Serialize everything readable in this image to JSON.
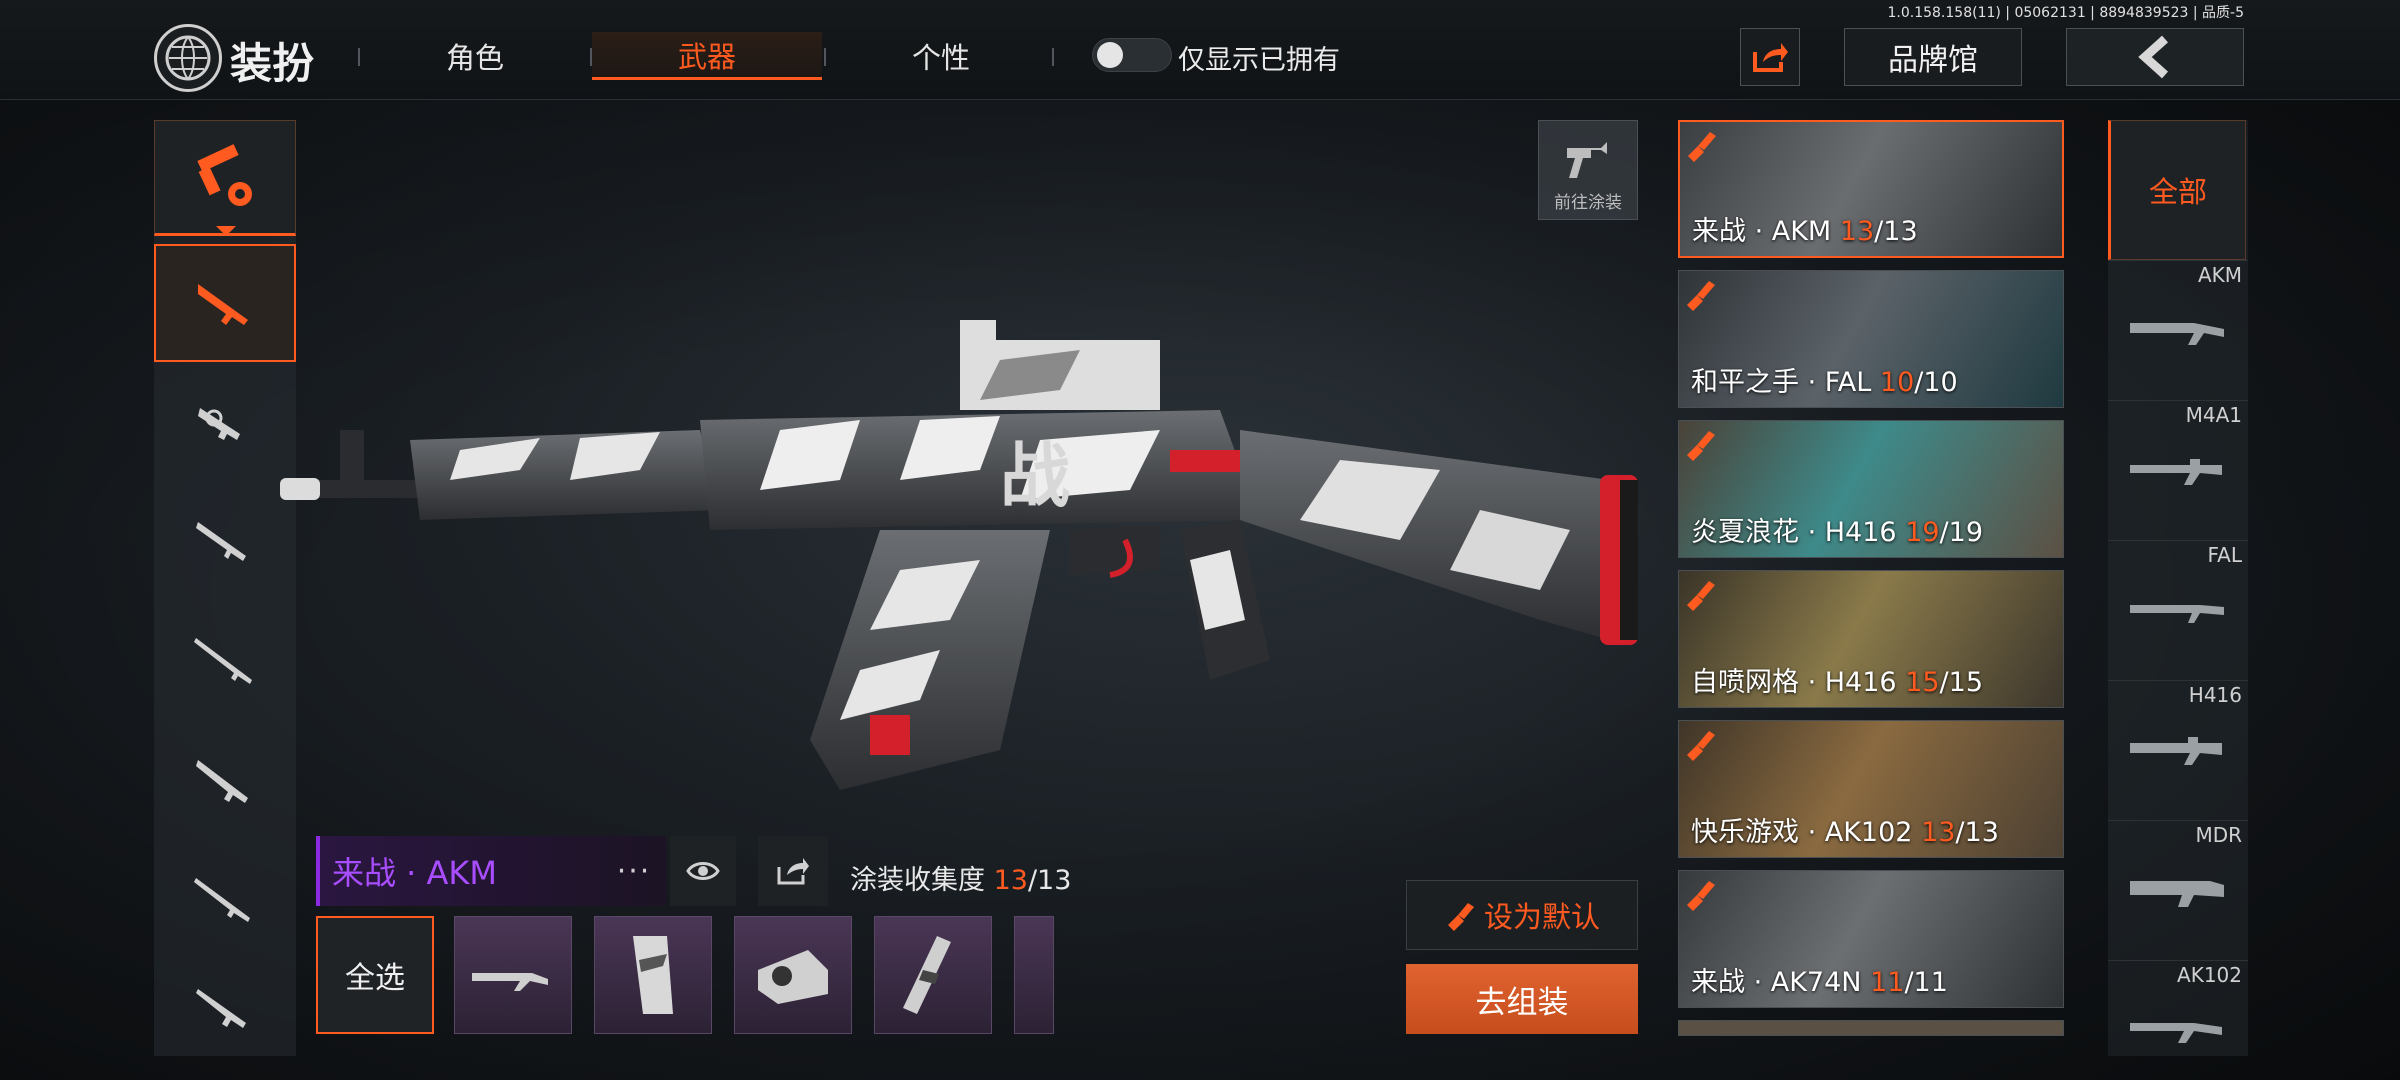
{
  "version": "1.0.158.158(11) | 05062131 | 8894839523 | 品质-5",
  "header": {
    "title": "装扮",
    "tabs": [
      "角色",
      "武器",
      "个性"
    ],
    "active_tab": "武器",
    "toggle_label": "仅显示已拥有",
    "toggle_on": false,
    "brand_label": "品牌馆"
  },
  "goto_paint_label": "前往涂装",
  "current_skin": {
    "name": "来战 · AKM",
    "collect_label": "涂装收集度",
    "collect_current": "13",
    "collect_total": "/13",
    "more": "···"
  },
  "parts": {
    "select_all": "全选"
  },
  "actions": {
    "set_default": "设为默认",
    "assemble": "去组装"
  },
  "skins": [
    {
      "name": "来战 · AKM",
      "owned": "13",
      "total": "/13"
    },
    {
      "name": "和平之手 · FAL",
      "owned": "10",
      "total": "/10"
    },
    {
      "name": "炎夏浪花 · H416",
      "owned": "19",
      "total": "/19"
    },
    {
      "name": "自喷网格 · H416",
      "owned": "15",
      "total": "/15"
    },
    {
      "name": "快乐游戏 · AK102",
      "owned": "13",
      "total": "/13"
    },
    {
      "name": "来战 · AK74N",
      "owned": "11",
      "total": "/11"
    }
  ],
  "filters": {
    "all": "全部",
    "items": [
      "AKM",
      "M4A1",
      "FAL",
      "H416",
      "MDR",
      "AK102"
    ]
  },
  "colors": {
    "accent": "#ff5a1f",
    "purple": "#a84dff"
  }
}
